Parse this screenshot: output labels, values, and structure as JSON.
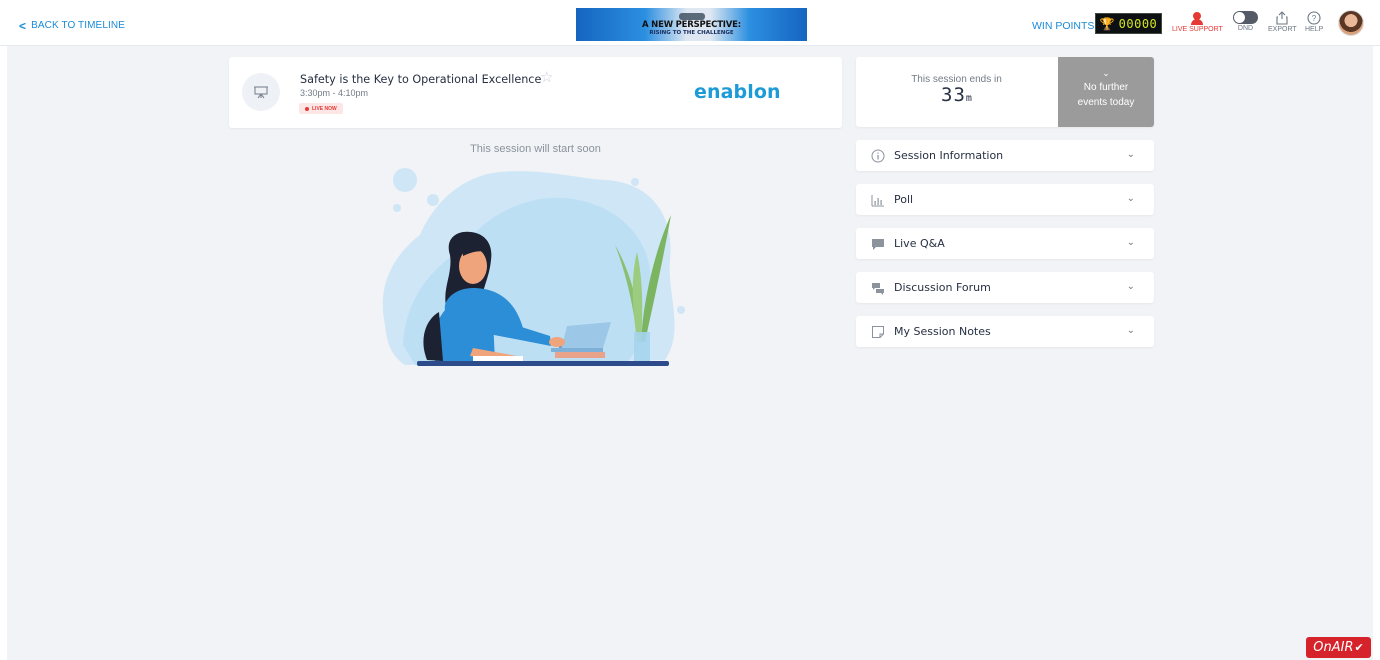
{
  "header": {
    "back_label": "BACK TO TIMELINE",
    "banner": {
      "title": "A NEW PERSPECTIVE:",
      "subtitle": "RISING TO THE CHALLENGE"
    },
    "win_points_label": "WIN POINTS",
    "win_points_value": "00000",
    "tools": {
      "live_support": "LIVE SUPPORT",
      "dnd": "DND",
      "export": "EXPORT",
      "help": "HELP"
    },
    "colors": {
      "accent": "#1a8bd6",
      "live": "#e53935",
      "points": "#d6e61c"
    }
  },
  "session": {
    "title": "Safety is the Key to Operational Excellence",
    "time": "3:30pm - 4:10pm",
    "badge": "LIVE NOW",
    "sponsor": "enablon",
    "start_message": "This session will start soon"
  },
  "countdown": {
    "label": "This session ends in",
    "value": "33",
    "unit": "m",
    "no_events_line1": "No further",
    "no_events_line2": "events today"
  },
  "accordions": [
    {
      "label": "Session Information",
      "icon": "info-icon"
    },
    {
      "label": "Poll",
      "icon": "poll-icon"
    },
    {
      "label": "Live Q&A",
      "icon": "chat-bubble-icon"
    },
    {
      "label": "Discussion Forum",
      "icon": "forum-icon"
    },
    {
      "label": "My Session Notes",
      "icon": "notes-icon"
    }
  ],
  "footer": {
    "onair_label": "OnAIR"
  }
}
